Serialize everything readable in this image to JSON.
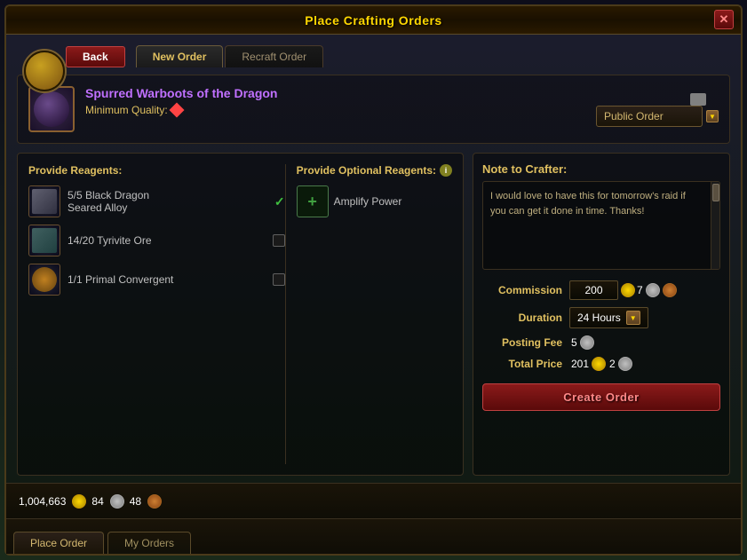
{
  "window": {
    "title": "Place Crafting Orders",
    "close_label": "✕"
  },
  "tabs": {
    "new_order_label": "New Order",
    "recraft_order_label": "Recraft Order"
  },
  "back_button_label": "Back",
  "item": {
    "name": "Spurred Warboots of the Dragon",
    "quality_label": "Minimum Quality:",
    "order_type": "Public Order"
  },
  "reagents": {
    "section_label": "Provide Reagents:",
    "items": [
      {
        "name": "5/5 Black Dragon\nSeared Alloy",
        "checked": true,
        "checkbox": false
      },
      {
        "name": "14/20 Tyrivite Ore",
        "checked": false,
        "checkbox": true
      },
      {
        "name": "1/1 Primal Convergent",
        "checked": false,
        "checkbox": true
      }
    ]
  },
  "optional_reagents": {
    "section_label": "Provide Optional Reagents:",
    "items": [
      {
        "name": "Amplify Power"
      }
    ]
  },
  "note": {
    "label": "Note to Crafter:",
    "text": "I would love to have this for tomorrow's raid if you can get it done in time. Thanks!"
  },
  "commission": {
    "label": "Commission",
    "gold_value": "200",
    "silver_value": "7"
  },
  "duration": {
    "label": "Duration",
    "value": "24 Hours"
  },
  "posting_fee": {
    "label": "Posting Fee",
    "value": "5"
  },
  "total_price": {
    "label": "Total Price",
    "gold_value": "201",
    "silver_value": "2"
  },
  "create_order_button_label": "Create Order",
  "status_bar": {
    "gold": "1,004,663",
    "silver": "84",
    "bronze": "48"
  },
  "bottom_tabs": {
    "place_order_label": "Place Order",
    "my_orders_label": "My Orders"
  }
}
